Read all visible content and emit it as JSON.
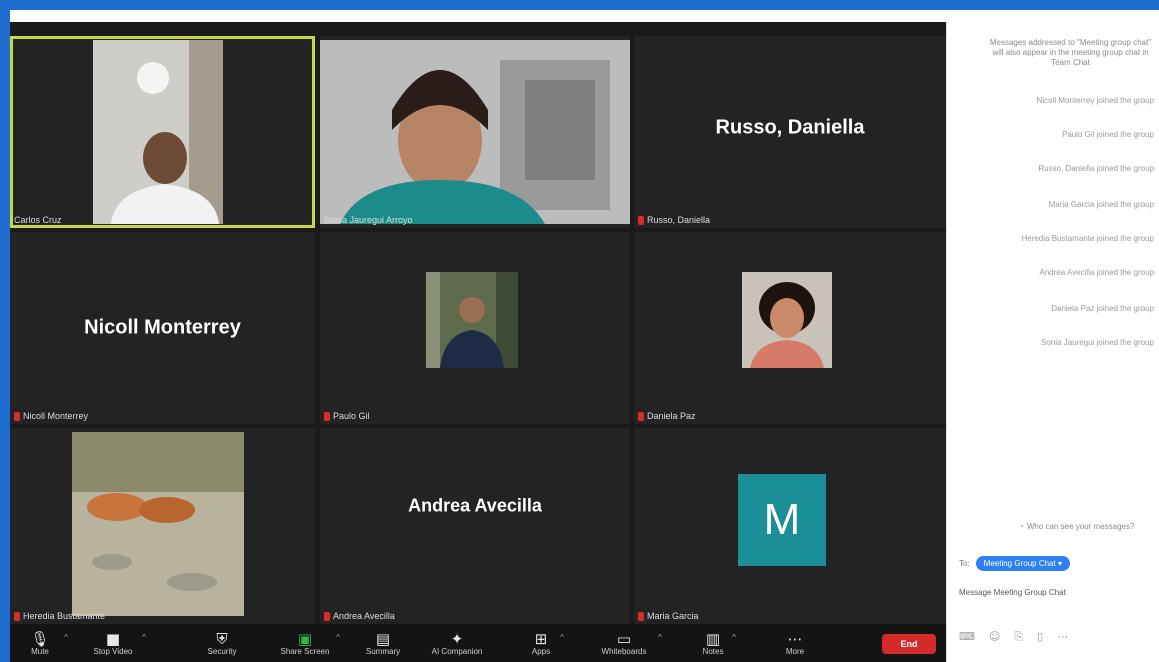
{
  "participants": [
    {
      "label": "Carlos Cruz",
      "big_name": "",
      "muted": false,
      "video": "person-bald",
      "active": true
    },
    {
      "label": "Sonia Jauregui Arroyo",
      "big_name": "",
      "muted": false,
      "video": "person-woman",
      "active": false
    },
    {
      "label": "Russo, Daniella",
      "big_name": "Russo, Daniella",
      "muted": true,
      "video": "none",
      "active": false
    },
    {
      "label": "Nicoll Monterrey",
      "big_name": "Nicoll Monterrey",
      "muted": true,
      "video": "none",
      "active": false
    },
    {
      "label": "Paulo Gil",
      "big_name": "",
      "muted": true,
      "video": "photo-man",
      "active": false
    },
    {
      "label": "Daniela Paz",
      "big_name": "",
      "muted": true,
      "video": "photo-woman",
      "active": false
    },
    {
      "label": "Heredia Bustamante",
      "big_name": "",
      "muted": true,
      "video": "photo-cats",
      "active": false
    },
    {
      "label": "Andrea Avecilla",
      "big_name": "Andrea Avecilla",
      "muted": true,
      "video": "none",
      "active": false
    },
    {
      "label": "Maria Garcia",
      "big_name": "",
      "muted": true,
      "video": "avatar-M",
      "active": false
    }
  ],
  "avatar_letter": "M",
  "toolbar": {
    "mute": "Mute",
    "stop_video": "Stop Video",
    "security": "Security",
    "share_screen": "Share Screen",
    "summary": "Summary",
    "ai_companion": "AI Companion",
    "apps": "Apps",
    "whiteboards": "Whiteboards",
    "notes": "Notes",
    "more": "More",
    "end": "End"
  },
  "chat": {
    "system_message": "Messages addressed to \"Meeting group chat\" will also appear in the meeting group chat in Team Chat",
    "messages": [
      "Nicoll Monterrey joined the group",
      "Paulo Gil joined the group",
      "Russo, Daniella joined the group",
      "Maria Garcia joined the group",
      "Heredia Bustamante joined the group",
      "Andrea Avecilla joined the group",
      "Daniela Paz joined the group",
      "Sonia Jauregui joined the group"
    ],
    "who_can_see": "Who can see your messages?",
    "to_label": "To:",
    "recipient": "Meeting Group Chat",
    "input_placeholder": "Message Meeting Group Chat"
  },
  "colors": {
    "frame_blue": "#1e6fd1",
    "active_speaker": "#c8d64a",
    "end_red": "#d42a2a",
    "avatar_teal": "#1a8f98",
    "share_green": "#2fb84a"
  }
}
